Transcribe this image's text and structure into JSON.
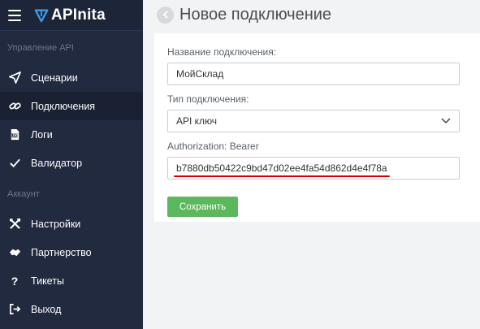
{
  "app": {
    "name": "APInita"
  },
  "sidebar": {
    "section_api": "Управление API",
    "section_account": "Аккаунт",
    "items_api": [
      {
        "label": "Сценарии",
        "icon": "send-icon",
        "active": false
      },
      {
        "label": "Подключения",
        "icon": "link-icon",
        "active": true
      },
      {
        "label": "Логи",
        "icon": "log-file-icon",
        "active": false
      },
      {
        "label": "Валидатор",
        "icon": "checkmark-icon",
        "active": false
      }
    ],
    "items_account": [
      {
        "label": "Настройки",
        "icon": "tools-icon"
      },
      {
        "label": "Партнерство",
        "icon": "handshake-icon"
      },
      {
        "label": "Тикеты",
        "icon": "question-icon"
      },
      {
        "label": "Выход",
        "icon": "logout-icon"
      }
    ]
  },
  "page": {
    "title": "Новое подключение"
  },
  "form": {
    "name_label": "Название подключения:",
    "name_value": "МойСклад",
    "type_label": "Тип подключения:",
    "type_value": "API ключ",
    "auth_label": "Authorization: Bearer",
    "auth_value": "b7880db50422c9bd47d02ee4fa54d862d4e4f78a",
    "save_label": "Сохранить"
  },
  "colors": {
    "sidebar_bg": "#222a3f",
    "accent_blue": "#3d9be9",
    "save_green": "#5cb85c",
    "underline_red": "#d40000"
  }
}
